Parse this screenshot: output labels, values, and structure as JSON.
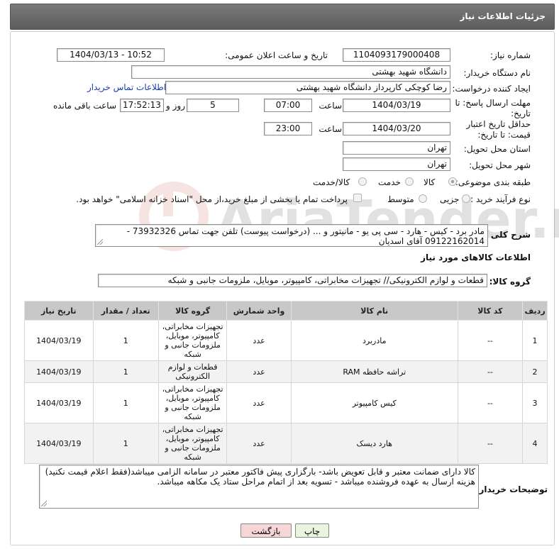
{
  "header": {
    "title": "جزئیات اطلاعات نیاز"
  },
  "labels": {
    "need_number": "شماره نیاز:",
    "announce_datetime": "تاریخ و ساعت اعلان عمومی:",
    "buyer_org": "نام دستگاه خریدار:",
    "requester": "ایجاد کننده درخواست:",
    "reply_deadline": "مهلت ارسال پاسخ: تا تاریخ:",
    "time": "ساعت",
    "days_and": "روز و",
    "hours_left": "ساعت باقی مانده",
    "price_validity": "حداقل تاریخ اعتبار قیمت: تا تاریخ:",
    "delivery_province": "استان محل تحویل:",
    "delivery_city": "شهر محل تحویل:",
    "category": "طبقه بندی موضوعی:",
    "purchase_type": "نوع فرآیند خرید :",
    "general_desc": "شرح کلی نیاز:",
    "goods_info": "اطلاعات کالاهای مورد نیاز",
    "goods_group": "گروه کالا:",
    "buyer_notes": "توضیحات خریدار:"
  },
  "fields": {
    "need_number": "1104093179000408",
    "announce_datetime": "1404/03/13 - 10:52",
    "buyer_org": "دانشگاه شهید بهشتی",
    "requester": "رضا کوچکی کارپرداز دانشگاه شهید بهشتی",
    "contact_link": "اطلاعات تماس خریدار",
    "reply_date": "1404/03/19",
    "reply_time": "07:00",
    "days_left": "5",
    "time_left": "17:52:13",
    "price_date": "1404/03/20",
    "price_time": "23:00",
    "province": "تهران",
    "city": "تهران"
  },
  "category_options": [
    {
      "label": "کالا",
      "selected": true
    },
    {
      "label": "خدمت",
      "selected": false
    },
    {
      "label": "کالا/خدمت",
      "selected": false
    }
  ],
  "purchase_options": [
    {
      "label": "جزیی",
      "selected": false
    },
    {
      "label": "متوسط",
      "selected": false
    }
  ],
  "treasury_note": "پرداخت تمام یا بخشی از مبلغ خرید،از محل \"اسناد خزانه اسلامی\" خواهد بود.",
  "general_desc": "مادر برد - کیس - هارد - سی پی یو - مانیتور و ... (درخواست پیوست) تلفن جهت تماس 73932326 - 09122162014 آقای اسدیان",
  "goods_group": "قطعات و لوازم الکترونیکی// تجهیزات مخابراتی، کامپیوتر، موبایل، ملزومات جانبی و شبکه",
  "table": {
    "headers": [
      "ردیف",
      "کد کالا",
      "نام کالا",
      "واحد شمارش",
      "گروه کالا",
      "تعداد / مقدار",
      "تاریخ نیاز"
    ],
    "rows": [
      [
        "1",
        "--",
        "مادربرد",
        "عدد",
        "تجهیزات مخابراتی، کامپیوتر، موبایل، ملزومات جانبی و شبکه",
        "1",
        "1404/03/19"
      ],
      [
        "2",
        "--",
        "تراشه حافظه RAM",
        "عدد",
        "قطعات و لوازم الکترونیکی",
        "1",
        "1404/03/19"
      ],
      [
        "3",
        "--",
        "کیس کامپیوتر",
        "عدد",
        "تجهیزات مخابراتی، کامپیوتر، موبایل، ملزومات جانبی و شبکه",
        "1",
        "1404/03/19"
      ],
      [
        "4",
        "--",
        "هارد دیسک",
        "عدد",
        "تجهیزات مخابراتی، کامپیوتر، موبایل، ملزومات جانبی و شبکه",
        "1",
        "1404/03/19"
      ]
    ]
  },
  "buyer_notes_line1": "کالا دارای ضمانت معتبر و قابل تعویض باشد- بارگزاری پیش فاکتور معتبر در سامانه الزامی میباشد(فقط اعلام قیمت نکنید)",
  "buyer_notes_line2": "هزینه ارسال به عهده فروشنده میباشد - تسویه بعد از اتمام مراحل ستاد یک مکاهه میباشد.",
  "buttons": {
    "print": "چاپ",
    "back": "بازگشت"
  },
  "watermark": "AriaTender.neT",
  "colors": {
    "header_bg": "#666666",
    "link": "#1a3fa8",
    "back_btn_bg": "#f6d6d6",
    "print_btn_bg": "#eaf5e0"
  }
}
